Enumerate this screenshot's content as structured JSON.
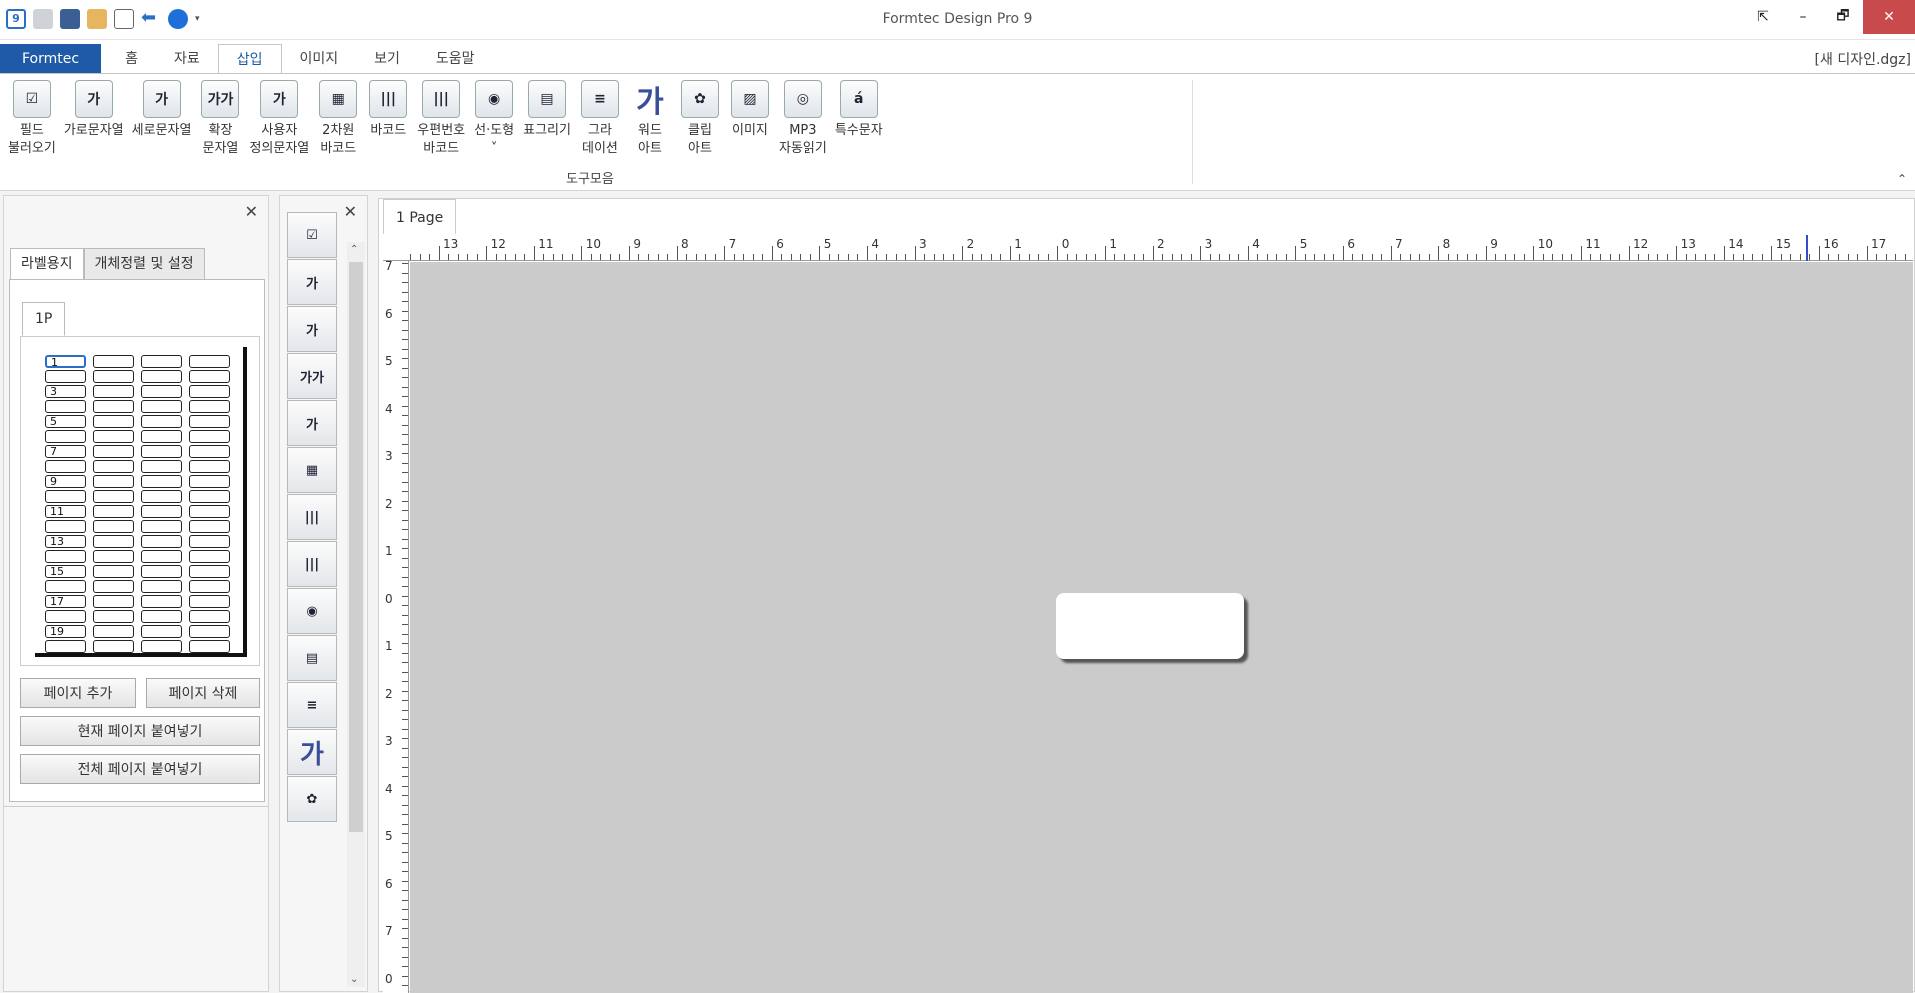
{
  "window": {
    "title": "Formtec Design Pro 9",
    "filename": "[새 디자인.dgz]",
    "controls": [
      "⇱",
      "–",
      "🗗",
      "✕"
    ]
  },
  "qat_icons": [
    "app-icon",
    "save-disabled-icon",
    "save-icon",
    "open-folder-icon",
    "print-preview-icon",
    "back-arrow-icon",
    "circle-icon",
    "dropdown-icon"
  ],
  "tabs": [
    "Formtec",
    "홈",
    "자료",
    "삽입",
    "이미지",
    "보기",
    "도움말"
  ],
  "active_tab": "삽입",
  "ribbon": {
    "group_label": "도구모음",
    "buttons": [
      {
        "label": "필드\n불러오기",
        "glyph": "☑"
      },
      {
        "label": "가로문자열",
        "glyph": "가"
      },
      {
        "label": "세로문자열",
        "glyph": "가"
      },
      {
        "label": "확장\n문자열",
        "glyph": "가가"
      },
      {
        "label": "사용자\n정의문자열",
        "glyph": "가"
      },
      {
        "label": "2차원\n바코드",
        "glyph": "▦"
      },
      {
        "label": "바코드",
        "glyph": "|||"
      },
      {
        "label": "우편번호\n바코드",
        "glyph": "|||"
      },
      {
        "label": "선·도형\n˅",
        "glyph": "◉"
      },
      {
        "label": "표그리기",
        "glyph": "▤"
      },
      {
        "label": "그라\n데이션",
        "glyph": "≡"
      },
      {
        "label": "워드\n아트",
        "glyph": "가"
      },
      {
        "label": "클립\n아트",
        "glyph": "✿"
      },
      {
        "label": "이미지",
        "glyph": "▨"
      },
      {
        "label": "MP3\n자동읽기",
        "glyph": "◎"
      },
      {
        "label": "특수문자",
        "glyph": "á"
      }
    ]
  },
  "left_panel": {
    "tabs": [
      "라벨용지",
      "개체정렬 및 설정"
    ],
    "page_tab": "1P",
    "cell_numbers": [
      "1",
      "3",
      "5",
      "7",
      "9",
      "11",
      "13",
      "15",
      "17",
      "19"
    ],
    "buttons": {
      "add_page": "페이지 추가",
      "delete_page": "페이지 삭제",
      "paste_current": "현재 페이지 붙여넣기",
      "paste_all": "전체 페이지 붙여넣기"
    }
  },
  "tool_panel": {
    "icons": [
      "field-icon",
      "horizontal-text-icon",
      "vertical-text-icon",
      "extended-text-icon",
      "custom-text-icon",
      "qr-code-icon",
      "barcode-icon",
      "postal-barcode-icon",
      "shape-icon",
      "table-icon",
      "gradation-icon",
      "word-art-icon",
      "clip-art-icon"
    ],
    "glyphs": [
      "☑",
      "가",
      "가",
      "가가",
      "가",
      "▦",
      "|||",
      "|||",
      "◉",
      "▤",
      "≡",
      "가",
      "✿"
    ]
  },
  "canvas": {
    "page_tab": "1 Page",
    "ruler_h": [
      "13",
      "12",
      "11",
      "10",
      "9",
      "8",
      "7",
      "6",
      "5",
      "4",
      "3",
      "2",
      "1",
      "0",
      "1",
      "2",
      "3",
      "4",
      "5",
      "6",
      "7",
      "8",
      "9",
      "10",
      "11",
      "12",
      "13",
      "14",
      "15",
      "16",
      "17"
    ],
    "ruler_v": [
      "7",
      "6",
      "5",
      "4",
      "3",
      "2",
      "1",
      "0",
      "1",
      "2",
      "3",
      "4",
      "5",
      "6",
      "7",
      "0"
    ]
  }
}
